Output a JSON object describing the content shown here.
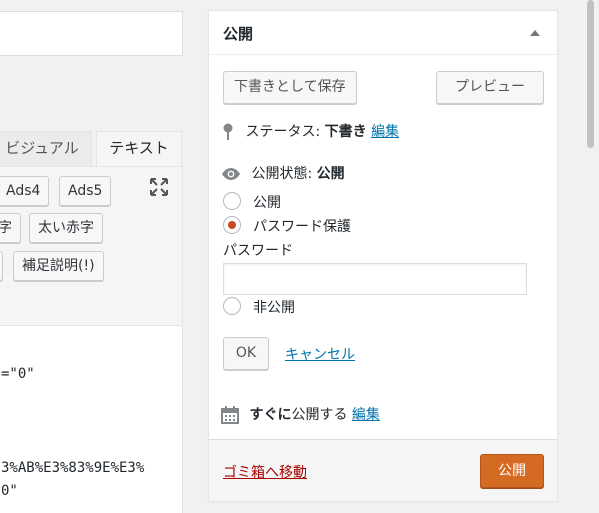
{
  "editor": {
    "tabs": [
      "ビジュアル",
      "テキスト"
    ],
    "quicktags": [
      "Ads4",
      "Ads5",
      "字",
      "太い赤字",
      "補足説明(!)"
    ],
    "code_lines": [
      "=\"0\"",
      "3%AB%E3%83%9E%E3%",
      "0\""
    ]
  },
  "publish_box": {
    "title": "公開",
    "save_draft_label": "下書きとして保存",
    "preview_label": "プレビュー",
    "status_label": "ステータス:",
    "status_value": "下書き",
    "edit_status_link": "編集",
    "visibility_label": "公開状態:",
    "visibility_value": "公開",
    "visibility_options": [
      "公開",
      "パスワード保護",
      "非公開"
    ],
    "selected_visibility": "パスワード保護",
    "password_label": "パスワード",
    "password_value": "",
    "ok_label": "OK",
    "cancel_link": "キャンセル",
    "schedule_strong": "すぐに",
    "schedule_text": "公開する",
    "edit_schedule_link": "編集",
    "trash_link": "ゴミ箱へ移動",
    "publish_button": "公開"
  },
  "colors": {
    "accent_link": "#0073aa",
    "publish_button": "#d56a22",
    "trash_link": "#a00",
    "radio_checked": "#ca4a1f"
  },
  "icons": [
    "pin-icon",
    "eye-icon",
    "calendar-icon",
    "expand-icon",
    "collapse-arrow-icon"
  ]
}
